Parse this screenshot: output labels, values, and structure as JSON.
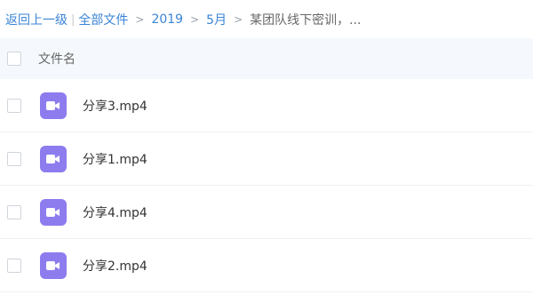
{
  "breadcrumb": {
    "back_label": "返回上一级",
    "all_files_label": "全部文件",
    "path": [
      "2019",
      "5月"
    ],
    "current": "某团队线下密训，..."
  },
  "header": {
    "column_label": "文件名"
  },
  "files": [
    {
      "name": "分享3.mp4",
      "icon": "video-file-icon"
    },
    {
      "name": "分享1.mp4",
      "icon": "video-file-icon"
    },
    {
      "name": "分享4.mp4",
      "icon": "video-file-icon"
    },
    {
      "name": "分享2.mp4",
      "icon": "video-file-icon"
    }
  ],
  "colors": {
    "link": "#3a84d6",
    "icon_purple": "#8c7cee",
    "header_bg": "#f5f9fd"
  }
}
